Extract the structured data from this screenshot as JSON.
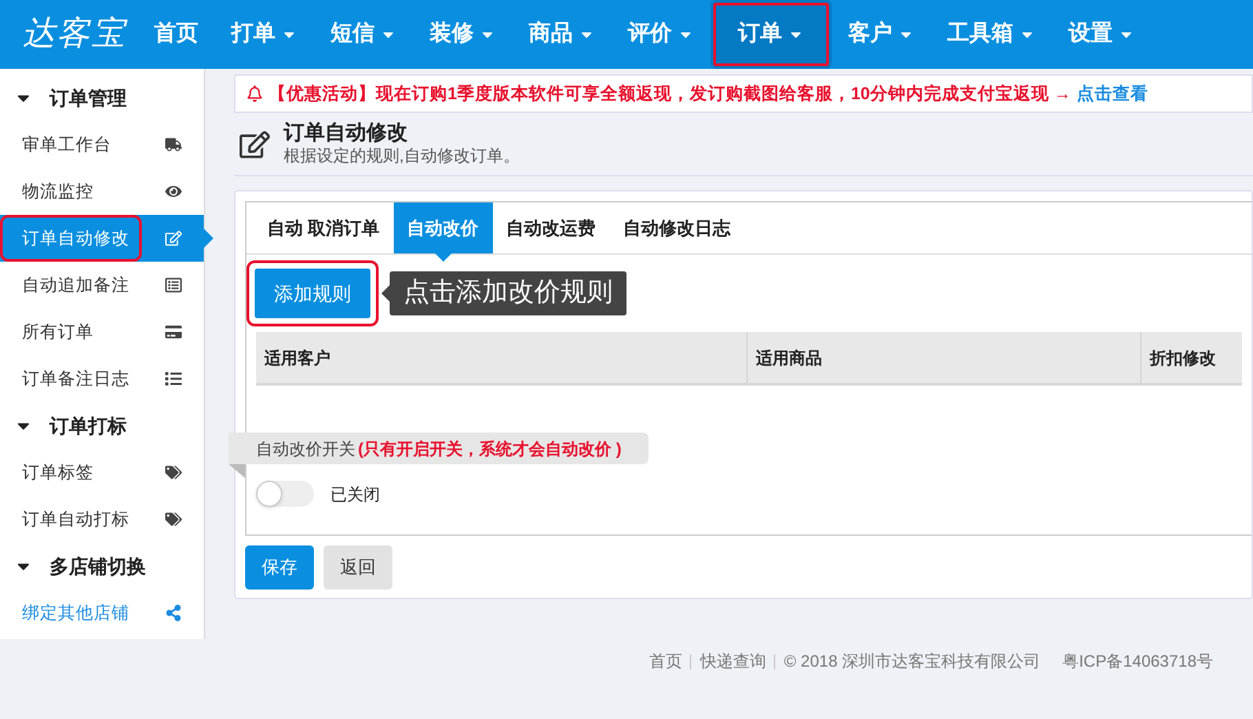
{
  "logo": "达客宝",
  "nav": [
    {
      "label": "首页",
      "dropdown": false,
      "selected": false,
      "highlighted": false
    },
    {
      "label": "打单",
      "dropdown": true,
      "selected": false,
      "highlighted": false
    },
    {
      "label": "短信",
      "dropdown": true,
      "selected": false,
      "highlighted": false
    },
    {
      "label": "装修",
      "dropdown": true,
      "selected": false,
      "highlighted": false
    },
    {
      "label": "商品",
      "dropdown": true,
      "selected": false,
      "highlighted": false
    },
    {
      "label": "评价",
      "dropdown": true,
      "selected": false,
      "highlighted": false
    },
    {
      "label": "订单",
      "dropdown": true,
      "selected": true,
      "highlighted": true
    },
    {
      "label": "客户",
      "dropdown": true,
      "selected": false,
      "highlighted": false
    },
    {
      "label": "工具箱",
      "dropdown": true,
      "selected": false,
      "highlighted": false
    },
    {
      "label": "设置",
      "dropdown": true,
      "selected": false,
      "highlighted": false
    }
  ],
  "sidebar": [
    {
      "title": "订单管理",
      "expanded": true,
      "items": [
        {
          "label": "审单工作台",
          "selected": false,
          "highlighted": false,
          "kind": "truck"
        },
        {
          "label": "物流监控",
          "selected": false,
          "highlighted": false,
          "kind": "eye"
        },
        {
          "label": "订单自动修改",
          "selected": true,
          "highlighted": true,
          "kind": "edit"
        },
        {
          "label": "自动追加备注",
          "selected": false,
          "highlighted": false,
          "kind": "listalt"
        },
        {
          "label": "所有订单",
          "selected": false,
          "highlighted": false,
          "kind": "card"
        },
        {
          "label": "订单备注日志",
          "selected": false,
          "highlighted": false,
          "kind": "list"
        }
      ]
    },
    {
      "title": "订单打标",
      "expanded": true,
      "items": [
        {
          "label": "订单标签",
          "selected": false,
          "highlighted": false,
          "kind": "tags"
        },
        {
          "label": "订单自动打标",
          "selected": false,
          "highlighted": false,
          "kind": "tags"
        }
      ]
    },
    {
      "title": "多店铺切换",
      "expanded": true,
      "items": [
        {
          "label": "绑定其他店铺",
          "selected": false,
          "highlighted": false,
          "kind": "share"
        }
      ]
    }
  ],
  "notice": {
    "text": "【优惠活动】现在订购1季度版本软件可享全额返现，发订购截图给客服，10分钟内完成支付宝返现 →",
    "link": "点击查看"
  },
  "page": {
    "title": "订单自动修改",
    "subtitle": "根据设定的规则,自动修改订单。"
  },
  "tabs": [
    {
      "label": "自动 取消订单",
      "selected": false
    },
    {
      "label": "自动改价",
      "selected": true
    },
    {
      "label": "自动改运费",
      "selected": false
    },
    {
      "label": "自动修改日志",
      "selected": false
    }
  ],
  "add_button": {
    "label": "添加规则",
    "highlighted": true
  },
  "tooltip": "点击添加改价规则",
  "table": {
    "columns": [
      "适用客户",
      "适用商品",
      "折扣修改"
    ]
  },
  "switch": {
    "label": "自动改价开关",
    "note": "(只有开启开关，系统才会自动改价 )",
    "on": false,
    "status": "已关闭"
  },
  "buttons": [
    {
      "label": "保存",
      "kind": "primary"
    },
    {
      "label": "返回",
      "kind": "default"
    }
  ],
  "footer": {
    "links": [
      "首页",
      "快递查询"
    ],
    "copyright": "© 2018 深圳市达客宝科技有限公司",
    "icp": "粤ICP备14063718号"
  }
}
